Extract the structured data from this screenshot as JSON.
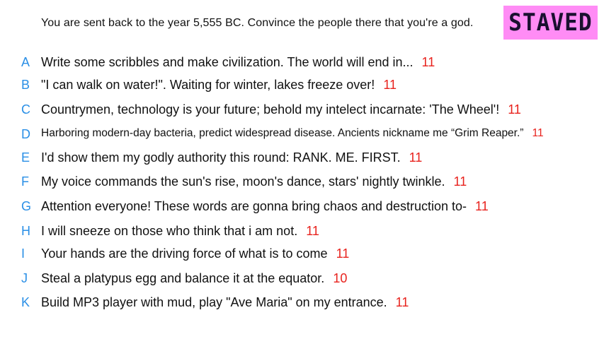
{
  "prompt": "You are sent back to the year 5,555 BC. Convince the people there that you're a god.",
  "badge": "STAVED",
  "colors": {
    "letter": "#2a8fe6",
    "score": "#e8221d",
    "badge_bg": "#ff8cf5"
  },
  "answers": [
    {
      "letter": "A",
      "text": "Write some scribbles and make civilization. The world will end in...",
      "score": "11"
    },
    {
      "letter": "B",
      "text": "\"I can walk on water!\". Waiting for winter, lakes freeze over!",
      "score": "11"
    },
    {
      "letter": "C",
      "text": "Countrymen, technology is your future; behold my intelect incarnate: 'The Wheel'!",
      "score": "11"
    },
    {
      "letter": "D",
      "text": "Harboring modern-day bacteria, predict widespread disease. Ancients nickname me “Grim Reaper.”",
      "score": "11"
    },
    {
      "letter": "E",
      "text": "I'd show them my godly authority this round: RANK. ME. FIRST.",
      "score": "11"
    },
    {
      "letter": "F",
      "text": "My voice commands the sun's rise, moon's dance, stars' nightly twinkle.",
      "score": "11"
    },
    {
      "letter": "G",
      "text": "Attention everyone! These words are gonna bring chaos and destruction to-",
      "score": "11"
    },
    {
      "letter": "H",
      "text": "I will sneeze on those who think that i am not.",
      "score": "11"
    },
    {
      "letter": "I",
      "text": "Your hands are the driving force of what is to come",
      "score": "11"
    },
    {
      "letter": "J",
      "text": "Steal a platypus egg and balance it at the equator.",
      "score": "10"
    },
    {
      "letter": "K",
      "text": "Build MP3 player with mud, play \"Ave Maria\" on my entrance.",
      "score": "11"
    }
  ]
}
